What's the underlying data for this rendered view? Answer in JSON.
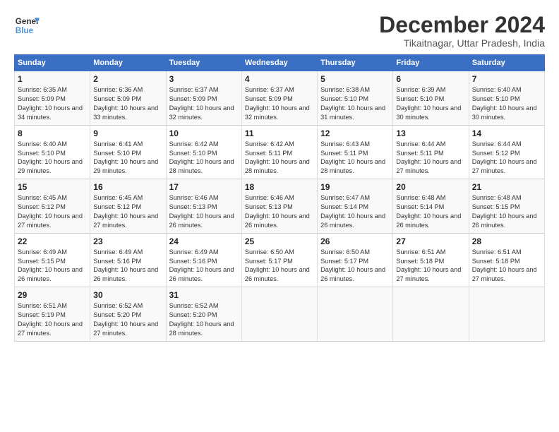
{
  "logo": {
    "line1": "General",
    "line2": "Blue"
  },
  "title": "December 2024",
  "location": "Tikaitnagar, Uttar Pradesh, India",
  "days_header": [
    "Sunday",
    "Monday",
    "Tuesday",
    "Wednesday",
    "Thursday",
    "Friday",
    "Saturday"
  ],
  "weeks": [
    [
      {
        "day": "1",
        "sunrise": "Sunrise: 6:35 AM",
        "sunset": "Sunset: 5:09 PM",
        "daylight": "Daylight: 10 hours and 34 minutes."
      },
      {
        "day": "2",
        "sunrise": "Sunrise: 6:36 AM",
        "sunset": "Sunset: 5:09 PM",
        "daylight": "Daylight: 10 hours and 33 minutes."
      },
      {
        "day": "3",
        "sunrise": "Sunrise: 6:37 AM",
        "sunset": "Sunset: 5:09 PM",
        "daylight": "Daylight: 10 hours and 32 minutes."
      },
      {
        "day": "4",
        "sunrise": "Sunrise: 6:37 AM",
        "sunset": "Sunset: 5:09 PM",
        "daylight": "Daylight: 10 hours and 32 minutes."
      },
      {
        "day": "5",
        "sunrise": "Sunrise: 6:38 AM",
        "sunset": "Sunset: 5:10 PM",
        "daylight": "Daylight: 10 hours and 31 minutes."
      },
      {
        "day": "6",
        "sunrise": "Sunrise: 6:39 AM",
        "sunset": "Sunset: 5:10 PM",
        "daylight": "Daylight: 10 hours and 30 minutes."
      },
      {
        "day": "7",
        "sunrise": "Sunrise: 6:40 AM",
        "sunset": "Sunset: 5:10 PM",
        "daylight": "Daylight: 10 hours and 30 minutes."
      }
    ],
    [
      {
        "day": "8",
        "sunrise": "Sunrise: 6:40 AM",
        "sunset": "Sunset: 5:10 PM",
        "daylight": "Daylight: 10 hours and 29 minutes."
      },
      {
        "day": "9",
        "sunrise": "Sunrise: 6:41 AM",
        "sunset": "Sunset: 5:10 PM",
        "daylight": "Daylight: 10 hours and 29 minutes."
      },
      {
        "day": "10",
        "sunrise": "Sunrise: 6:42 AM",
        "sunset": "Sunset: 5:10 PM",
        "daylight": "Daylight: 10 hours and 28 minutes."
      },
      {
        "day": "11",
        "sunrise": "Sunrise: 6:42 AM",
        "sunset": "Sunset: 5:11 PM",
        "daylight": "Daylight: 10 hours and 28 minutes."
      },
      {
        "day": "12",
        "sunrise": "Sunrise: 6:43 AM",
        "sunset": "Sunset: 5:11 PM",
        "daylight": "Daylight: 10 hours and 28 minutes."
      },
      {
        "day": "13",
        "sunrise": "Sunrise: 6:44 AM",
        "sunset": "Sunset: 5:11 PM",
        "daylight": "Daylight: 10 hours and 27 minutes."
      },
      {
        "day": "14",
        "sunrise": "Sunrise: 6:44 AM",
        "sunset": "Sunset: 5:12 PM",
        "daylight": "Daylight: 10 hours and 27 minutes."
      }
    ],
    [
      {
        "day": "15",
        "sunrise": "Sunrise: 6:45 AM",
        "sunset": "Sunset: 5:12 PM",
        "daylight": "Daylight: 10 hours and 27 minutes."
      },
      {
        "day": "16",
        "sunrise": "Sunrise: 6:45 AM",
        "sunset": "Sunset: 5:12 PM",
        "daylight": "Daylight: 10 hours and 27 minutes."
      },
      {
        "day": "17",
        "sunrise": "Sunrise: 6:46 AM",
        "sunset": "Sunset: 5:13 PM",
        "daylight": "Daylight: 10 hours and 26 minutes."
      },
      {
        "day": "18",
        "sunrise": "Sunrise: 6:46 AM",
        "sunset": "Sunset: 5:13 PM",
        "daylight": "Daylight: 10 hours and 26 minutes."
      },
      {
        "day": "19",
        "sunrise": "Sunrise: 6:47 AM",
        "sunset": "Sunset: 5:14 PM",
        "daylight": "Daylight: 10 hours and 26 minutes."
      },
      {
        "day": "20",
        "sunrise": "Sunrise: 6:48 AM",
        "sunset": "Sunset: 5:14 PM",
        "daylight": "Daylight: 10 hours and 26 minutes."
      },
      {
        "day": "21",
        "sunrise": "Sunrise: 6:48 AM",
        "sunset": "Sunset: 5:15 PM",
        "daylight": "Daylight: 10 hours and 26 minutes."
      }
    ],
    [
      {
        "day": "22",
        "sunrise": "Sunrise: 6:49 AM",
        "sunset": "Sunset: 5:15 PM",
        "daylight": "Daylight: 10 hours and 26 minutes."
      },
      {
        "day": "23",
        "sunrise": "Sunrise: 6:49 AM",
        "sunset": "Sunset: 5:16 PM",
        "daylight": "Daylight: 10 hours and 26 minutes."
      },
      {
        "day": "24",
        "sunrise": "Sunrise: 6:49 AM",
        "sunset": "Sunset: 5:16 PM",
        "daylight": "Daylight: 10 hours and 26 minutes."
      },
      {
        "day": "25",
        "sunrise": "Sunrise: 6:50 AM",
        "sunset": "Sunset: 5:17 PM",
        "daylight": "Daylight: 10 hours and 26 minutes."
      },
      {
        "day": "26",
        "sunrise": "Sunrise: 6:50 AM",
        "sunset": "Sunset: 5:17 PM",
        "daylight": "Daylight: 10 hours and 26 minutes."
      },
      {
        "day": "27",
        "sunrise": "Sunrise: 6:51 AM",
        "sunset": "Sunset: 5:18 PM",
        "daylight": "Daylight: 10 hours and 27 minutes."
      },
      {
        "day": "28",
        "sunrise": "Sunrise: 6:51 AM",
        "sunset": "Sunset: 5:18 PM",
        "daylight": "Daylight: 10 hours and 27 minutes."
      }
    ],
    [
      {
        "day": "29",
        "sunrise": "Sunrise: 6:51 AM",
        "sunset": "Sunset: 5:19 PM",
        "daylight": "Daylight: 10 hours and 27 minutes."
      },
      {
        "day": "30",
        "sunrise": "Sunrise: 6:52 AM",
        "sunset": "Sunset: 5:20 PM",
        "daylight": "Daylight: 10 hours and 27 minutes."
      },
      {
        "day": "31",
        "sunrise": "Sunrise: 6:52 AM",
        "sunset": "Sunset: 5:20 PM",
        "daylight": "Daylight: 10 hours and 28 minutes."
      },
      null,
      null,
      null,
      null
    ]
  ]
}
